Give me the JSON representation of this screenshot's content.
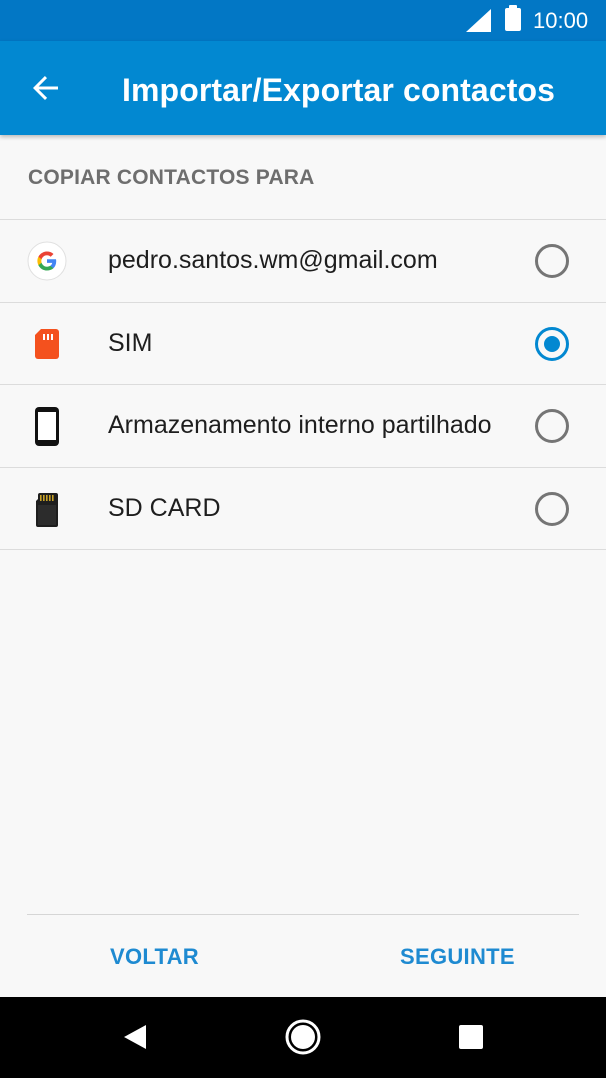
{
  "status_bar": {
    "time": "10:00",
    "icons": [
      "signal-icon",
      "battery-icon"
    ]
  },
  "app_bar": {
    "title": "Importar/Exportar contactos",
    "back_icon": "arrow-back-icon"
  },
  "section": {
    "header": "COPIAR CONTACTOS PARA"
  },
  "options": [
    {
      "label": "pedro.santos.wm@gmail.com",
      "icon": "google-icon",
      "selected": false
    },
    {
      "label": "SIM",
      "icon": "sim-card-icon",
      "selected": true
    },
    {
      "label": "Armazenamento interno partilhado",
      "icon": "phone-icon",
      "selected": false
    },
    {
      "label": "SD CARD",
      "icon": "sd-card-icon",
      "selected": false
    }
  ],
  "footer": {
    "back_label": "VOLTAR",
    "next_label": "SEGUINTE"
  },
  "nav_bar": {
    "icons": [
      "back-triangle-icon",
      "home-circle-icon",
      "recents-square-icon"
    ]
  },
  "colors": {
    "status_bar": "#0277c5",
    "app_bar": "#0288d1",
    "accent": "#0288d1",
    "sim": "#f4511e"
  }
}
